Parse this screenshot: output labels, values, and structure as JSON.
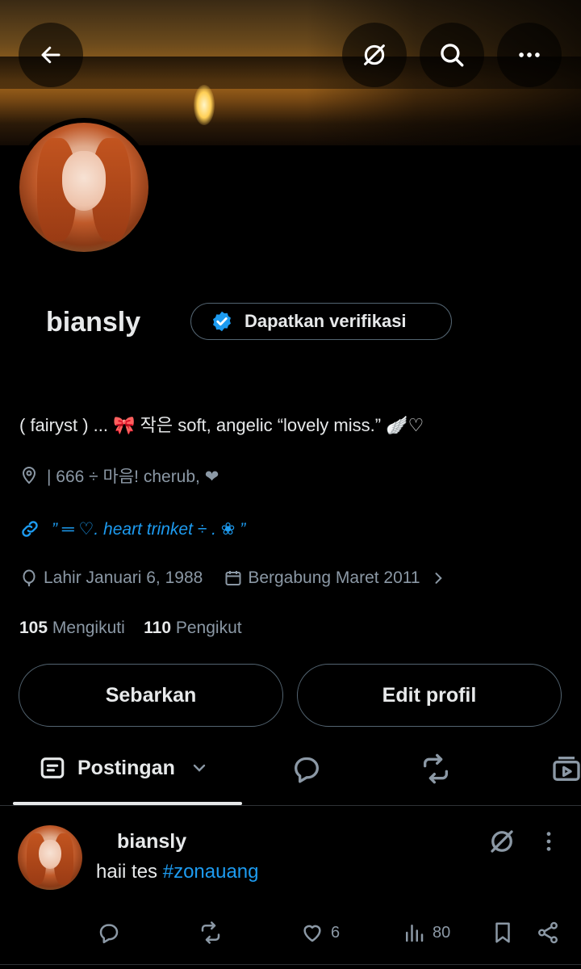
{
  "header": {
    "back_icon": "arrow-left-icon",
    "grok_icon": "grok-icon",
    "search_icon": "search-icon",
    "more_icon": "more-horizontal-icon"
  },
  "profile": {
    "name": "biansly",
    "verify_label": "Dapatkan verifikasi",
    "bio": "( fairyst ) ...  🎀  작은 soft, angelic “lovely miss.”  🪽♡",
    "location": "| 666 ÷ 마음!  cherub, ❤",
    "link": "” ═ ♡.  heart  trinket  ÷  .  ❀  ”",
    "birth": "Lahir Januari 6, 1988",
    "joined": "Bergabung Maret 2011",
    "following_count": "105",
    "following_label": "Mengikuti",
    "followers_count": "110",
    "followers_label": "Pengikut"
  },
  "actions": {
    "share_label": "Sebarkan",
    "edit_label": "Edit profil"
  },
  "tabs": {
    "active_label": "Postingan"
  },
  "post": {
    "author": "biansly",
    "text": "haii tes ",
    "hashtag": "#zonauang",
    "likes": "6",
    "views": "80"
  },
  "colors": {
    "accent": "#1d9bf0",
    "text": "#e7e9ea",
    "muted": "#8b98a5",
    "border": "#536471"
  }
}
